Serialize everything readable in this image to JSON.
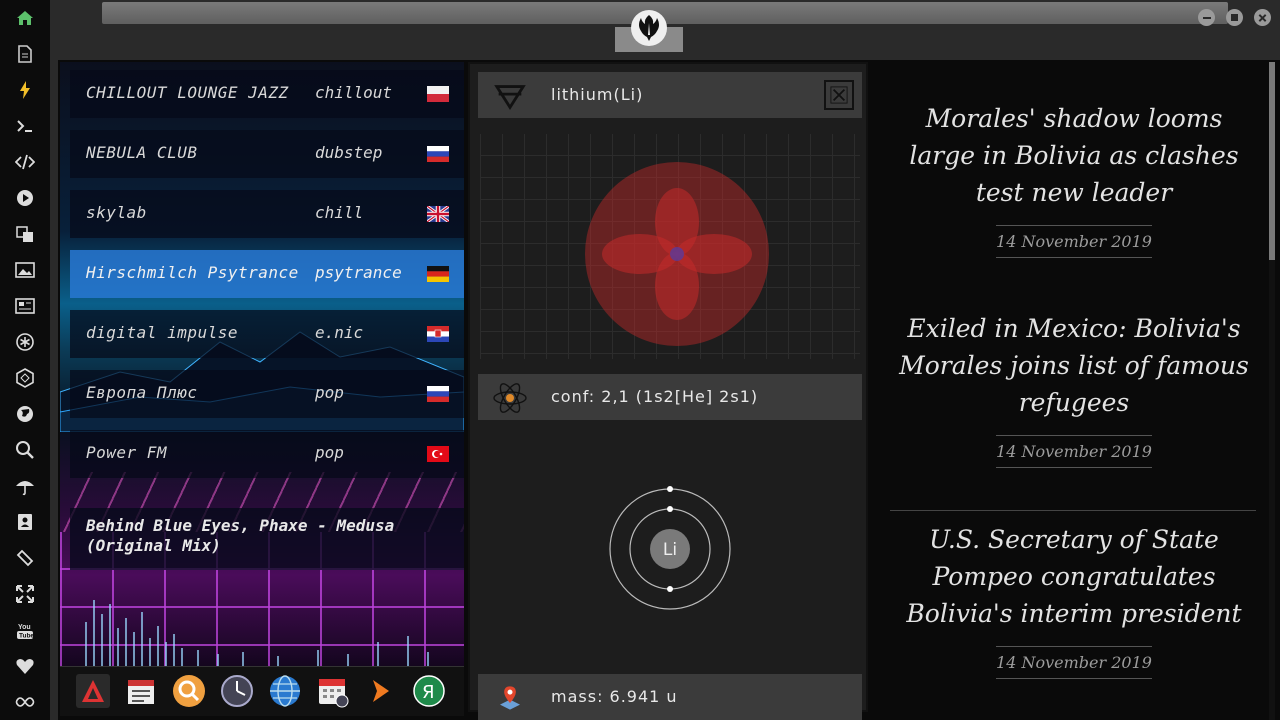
{
  "dock": {
    "items": [
      "home-icon",
      "document-icon",
      "lightning-icon",
      "terminal-icon",
      "code-icon",
      "play-icon",
      "translate-icon",
      "image-icon",
      "newspaper-icon",
      "asterisk-icon",
      "hexagon-icon",
      "globe-icon",
      "search-icon",
      "umbrella-icon",
      "contacts-icon",
      "link-icon",
      "fullscreen-icon",
      "youtube-icon",
      "heart-icon",
      "infinity-icon"
    ]
  },
  "window": {
    "logo": "rebel-alliance-icon",
    "buttons": [
      "minimize",
      "maximize",
      "close"
    ]
  },
  "radio": {
    "stations": [
      {
        "name": "CHILLOUT LOUNGE JAZZ",
        "genre": "chillout",
        "flag": "pl"
      },
      {
        "name": "NEBULA CLUB",
        "genre": "dubstep",
        "flag": "ru"
      },
      {
        "name": "skylab",
        "genre": "chill",
        "flag": "gb"
      },
      {
        "name": "Hirschmilch Psytrance",
        "genre": "psytrance",
        "flag": "de"
      },
      {
        "name": "digital impulse",
        "genre": "e.nic",
        "flag": "hr"
      },
      {
        "name": "Европа Плюс",
        "genre": "pop",
        "flag": "ru"
      },
      {
        "name": "Power FM",
        "genre": "pop",
        "flag": "tr"
      }
    ],
    "active_index": 3,
    "now_playing": "Behind Blue Eyes, Phaxe - Medusa (Original Mix)"
  },
  "taskbar": {
    "apps": [
      "arch-icon",
      "calendar-news-icon",
      "search-icon",
      "clock-icon",
      "globe-icon",
      "calendar-icon",
      "arrow-icon",
      "yandex-icon"
    ]
  },
  "element": {
    "name": "lithium(Li)",
    "symbol": "Li",
    "config": "conf: 2,1 (1s2[He] 2s1)",
    "mass": "mass: 6.941 u",
    "shells": [
      2,
      1
    ]
  },
  "news": {
    "articles": [
      {
        "headline": "Morales' shadow looms large in Bolivia as clashes test new leader",
        "date": "14 November 2019"
      },
      {
        "headline": "Exiled in Mexico: Bolivia's Morales joins list of famous refugees",
        "date": "14 November 2019"
      },
      {
        "headline": "U.S. Secretary of State Pompeo congratulates Bolivia's interim president",
        "date": "14 November 2019"
      }
    ]
  }
}
